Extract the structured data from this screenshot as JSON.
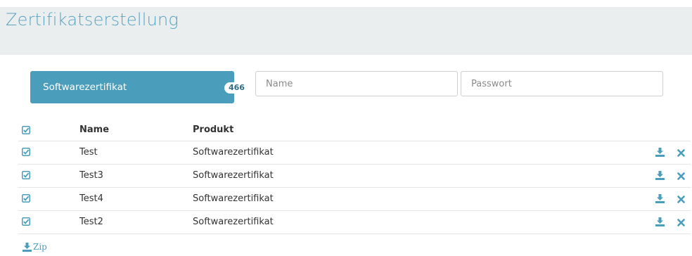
{
  "header": {
    "title": "Zertifikatserstellung"
  },
  "cert_button": {
    "label": "Softwarezertifikat",
    "count": "466"
  },
  "inputs": {
    "name_placeholder": "Name",
    "password_placeholder": "Passwort"
  },
  "table": {
    "headers": {
      "name": "Name",
      "product": "Produkt"
    },
    "rows": [
      {
        "name": "Test",
        "product": "Softwarezertifikat"
      },
      {
        "name": "Test3",
        "product": "Softwarezertifikat"
      },
      {
        "name": "Test4",
        "product": "Softwarezertifikat"
      },
      {
        "name": "Test2",
        "product": "Softwarezertifikat"
      }
    ]
  },
  "footer": {
    "zip_label": "Zip"
  },
  "icons": {
    "checkbox": "checked-checkbox-icon",
    "download": "download-icon",
    "delete": "close-icon"
  },
  "colors": {
    "accent": "#4a9dbb",
    "header_bg": "#eaeeee",
    "title": "#5aa3c0"
  }
}
